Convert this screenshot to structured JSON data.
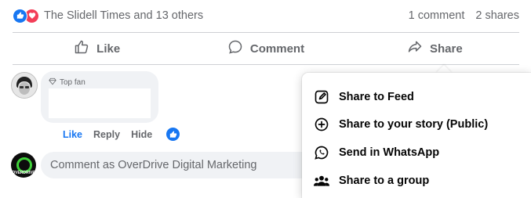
{
  "post_summary": {
    "reactions_text": "The Slidell Times and 13 others",
    "comments_count": "1 comment",
    "shares_count": "2 shares"
  },
  "post_actions": {
    "like_label": "Like",
    "comment_label": "Comment",
    "share_label": "Share"
  },
  "comment": {
    "badge": "Top fan",
    "actions": {
      "like": "Like",
      "reply": "Reply",
      "hide": "Hide"
    }
  },
  "composer": {
    "placeholder": "Comment as OverDrive Digital Marketing",
    "avatar_brand": "OVERDRIVE"
  },
  "share_menu": {
    "items": [
      {
        "label": "Share to Feed",
        "icon": "edit-icon"
      },
      {
        "label": "Share to your story (Public)",
        "icon": "plus-circle-icon"
      },
      {
        "label": "Send in WhatsApp",
        "icon": "whatsapp-icon"
      },
      {
        "label": "Share to a group",
        "icon": "group-icon"
      }
    ]
  },
  "colors": {
    "facebook_blue": "#1877f2",
    "love_red": "#f33e58",
    "text_secondary": "#65676b",
    "text_primary": "#050505",
    "bubble_bg": "#f0f2f5"
  }
}
